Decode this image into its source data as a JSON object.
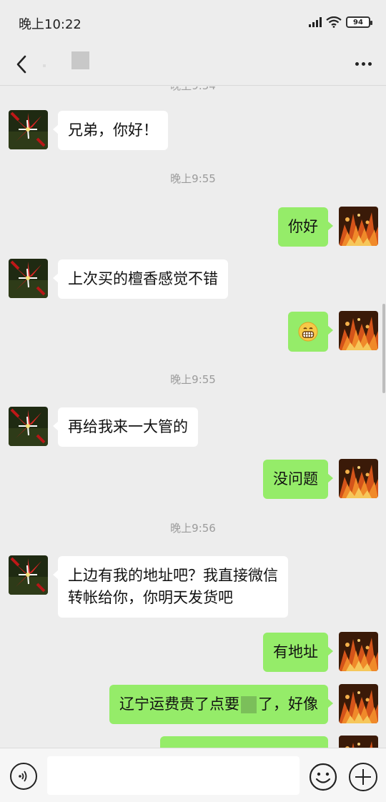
{
  "status_bar": {
    "time": "晚上10:22",
    "battery": "94"
  },
  "nav": {
    "title": ""
  },
  "chat": {
    "cut_off_time": "晚上9:54",
    "messages": [
      {
        "from": "them",
        "text": "兄弟，你好！"
      },
      {
        "time": "晚上9:55"
      },
      {
        "from": "me",
        "text": "你好"
      },
      {
        "from": "them",
        "text": "上次买的檀香感觉不错"
      },
      {
        "from": "me",
        "emoji": "grinning-face-emoji"
      },
      {
        "time": "晚上9:55"
      },
      {
        "from": "them",
        "text": "再给我来一大管的"
      },
      {
        "from": "me",
        "text": "没问题"
      },
      {
        "time": "晚上9:56"
      },
      {
        "from": "them",
        "text_line1": "上边有我的地址吧？我直接微信",
        "text_line2": "转帐给你，你明天发货吧"
      },
      {
        "from": "me",
        "text": "有地址"
      },
      {
        "from": "me",
        "text_part1": "辽宁运费贵了点要",
        "text_part2": "了，好像"
      }
    ]
  },
  "input_bar": {
    "value": "",
    "placeholder": ""
  },
  "icons": {
    "back": "chevron-left-icon",
    "more": "more-dots-icon",
    "voice": "voice-icon",
    "emoji": "emoji-icon",
    "plus": "plus-icon"
  },
  "colors": {
    "background": "#ededed",
    "outgoing_bubble": "#95ec69",
    "incoming_bubble": "#ffffff",
    "timestamp": "#9b9b9b"
  }
}
